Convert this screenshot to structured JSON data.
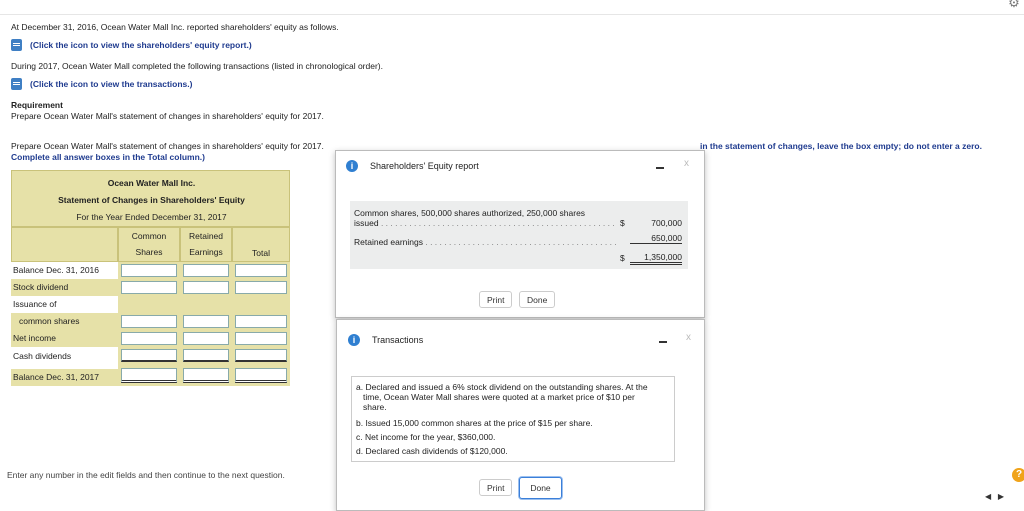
{
  "intro": {
    "line1": "At December 31, 2016, Ocean Water Mall Inc. reported shareholders' equity as follows.",
    "link1": "(Click the icon to view the shareholders' equity report.)",
    "line2": "During 2017, Ocean Water Mall completed the following transactions (listed in chronological order).",
    "link2": "(Click the icon to view the transactions.)",
    "req_title": "Requirement",
    "req_text": "Prepare Ocean Water Mall's statement of changes in shareholders' equity for 2017.",
    "instruction_start": "Prepare Ocean Water Mall's statement of changes in shareholders' equity for 2017.",
    "instruction_end": "in the statement of changes, leave the box empty; do not enter a zero.",
    "instruction_line2": "Complete all answer boxes in the Total column.)"
  },
  "statement": {
    "company": "Ocean Water Mall Inc.",
    "title": "Statement of Changes in Shareholders' Equity",
    "period": "For the Year Ended December 31, 2017",
    "col_common_1": "Common",
    "col_common_2": "Shares",
    "col_retained_1": "Retained",
    "col_retained_2": "Earnings",
    "col_total": "Total",
    "rows": {
      "balance_2016": "Balance Dec. 31, 2016",
      "stock_dividend": "Stock dividend",
      "issuance_of": "Issuance of",
      "common_shares": "common shares",
      "net_income": "Net income",
      "cash_dividends": "Cash dividends",
      "balance_2017": "Balance Dec. 31, 2017"
    }
  },
  "report_dialog": {
    "title": "Shareholders' Equity report",
    "close": "x",
    "line1a": "Common shares, 500,000 shares authorized, 250,000 shares",
    "line1b": "issued",
    "line1_currency": "$",
    "line1_value": "700,000",
    "line2": "Retained earnings",
    "line2_value": "650,000",
    "total_currency": "$",
    "total_value": "1,350,000",
    "print": "Print",
    "done": "Done"
  },
  "tx_dialog": {
    "title": "Transactions",
    "close": "x",
    "a1": "a. Declared and issued a 6% stock dividend on the outstanding shares. At the",
    "a2": "time, Ocean Water Mall shares were quoted at a market price of $10 per",
    "a3": "share.",
    "b": "b. Issued 15,000 common shares at the price of $15 per share.",
    "c": "c. Net income for the year, $360,000.",
    "d": "d. Declared cash dividends of $120,000.",
    "print": "Print",
    "done": "Done"
  },
  "footer": {
    "hint": "Enter any number in the edit fields and then continue to the next question.",
    "help": "?"
  },
  "colors": {
    "link": "#1f3b8f",
    "header_fill": "#e6e1a8",
    "info_icon": "#2f7fd1",
    "focus_border": "#3b7fd9"
  }
}
